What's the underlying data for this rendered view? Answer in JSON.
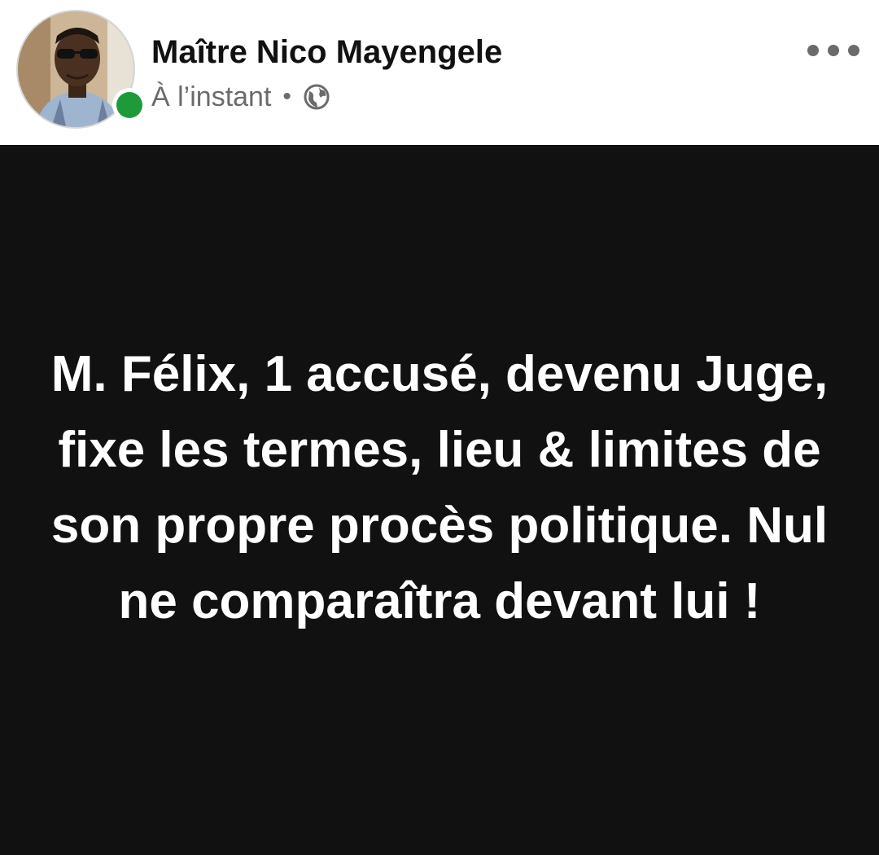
{
  "post": {
    "author": "Maître Nico Mayengele",
    "timestamp": "À l’instant",
    "separator": "•",
    "privacy_icon": "globe-icon",
    "more_icon": "more-options-icon",
    "text": "M. Félix, 1 accusé, devenu Juge, fixe les termes, lieu & limites de son propre procès politique. Nul ne comparaîtra devant lui !"
  },
  "colors": {
    "online_status": "#1f9a3a",
    "post_background": "#111111",
    "post_text": "#ffffff",
    "meta_text": "#6b6b6b"
  }
}
